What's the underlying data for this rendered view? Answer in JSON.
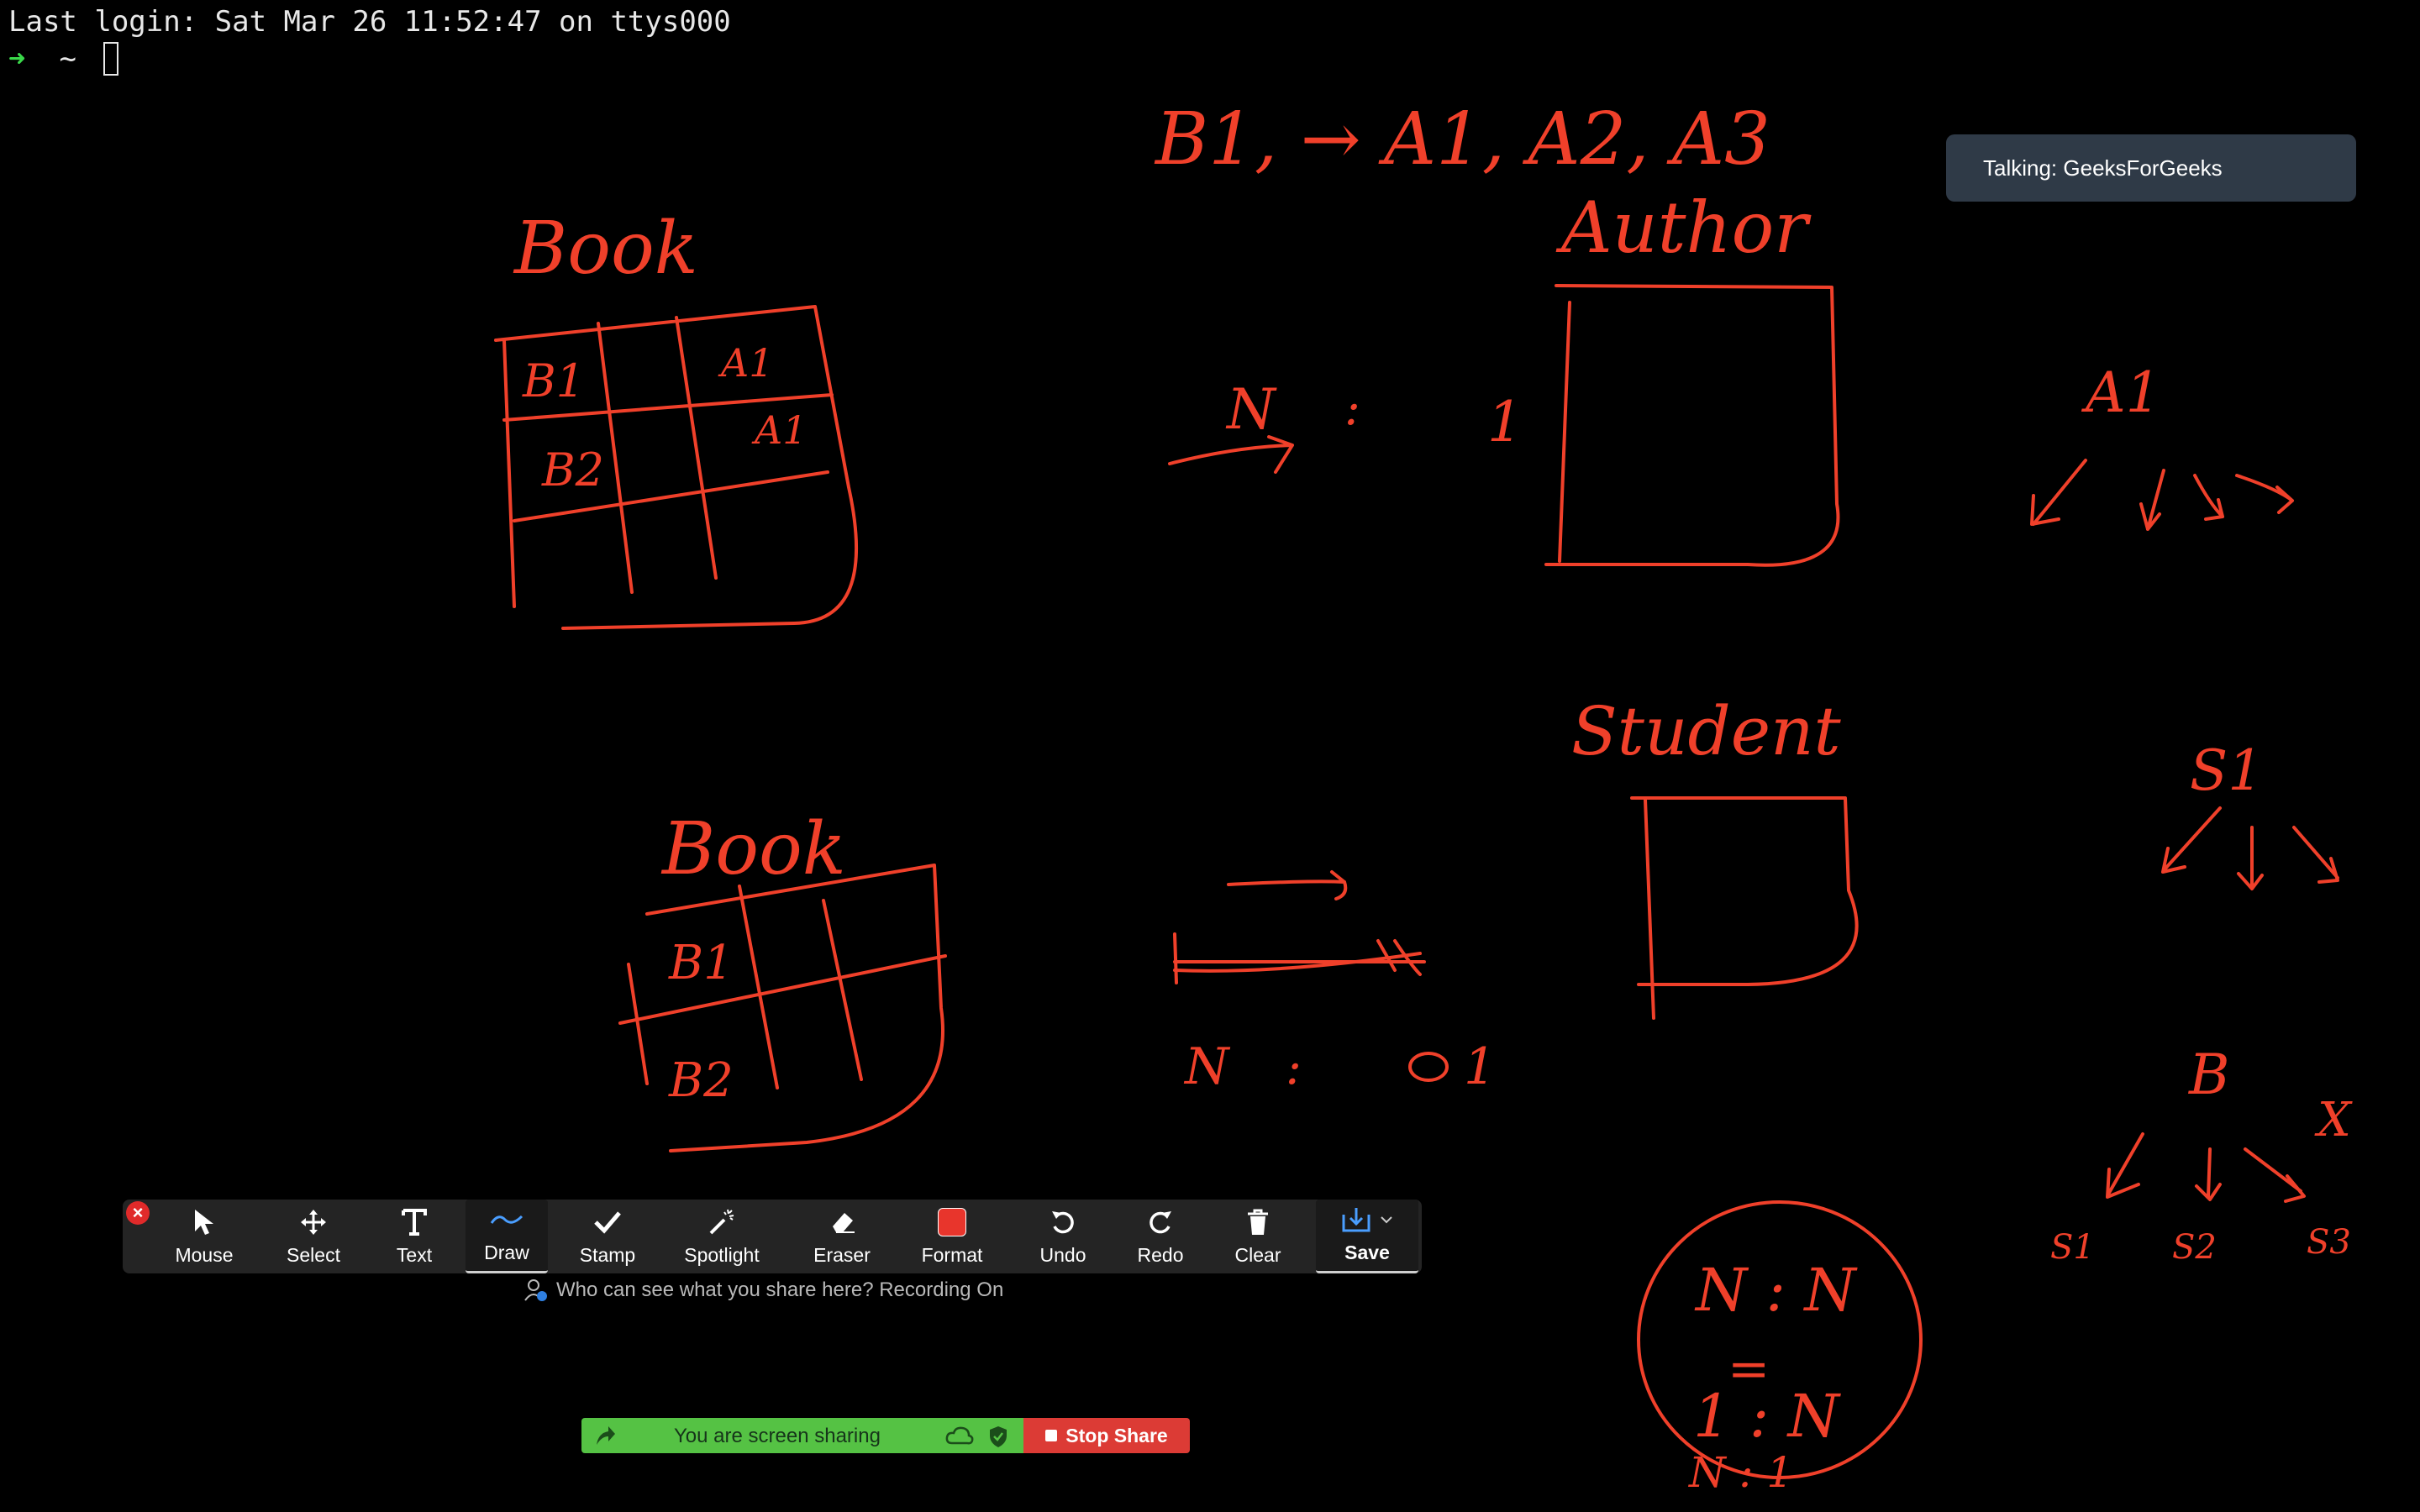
{
  "terminal": {
    "last_login": "Last login: Sat Mar 26 11:52:47 on ttys000",
    "prompt_arrow": "➜",
    "prompt_dir": "~"
  },
  "talking_badge": "Talking: GeeksForGeeks",
  "annotations": {
    "book_top": "Book",
    "book_bottom": "Book",
    "author": "Author",
    "student": "Student",
    "mapping_top": "B1, → A1, A2, A3",
    "ratio_n": "N",
    "ratio_colon": ":",
    "ratio_one": "1",
    "cell_b1": "B1",
    "cell_b2": "B2",
    "cell_a1": "A1",
    "cell_a1b": "A1",
    "tree_a1": "A1",
    "tree_s1": "S1",
    "tree_b": "B",
    "tree_x": "X",
    "leaf_s1": "S1",
    "leaf_s2": "S2",
    "leaf_s3": "S3",
    "n_to_n": "N : N",
    "one_to_n": "1 : N",
    "n_to_one": "N : 1",
    "equals": "="
  },
  "toolbar": {
    "close": "×",
    "tools": [
      {
        "label": "Mouse",
        "icon": "mouse-pointer-icon"
      },
      {
        "label": "Select",
        "icon": "move-arrows-icon"
      },
      {
        "label": "Text",
        "icon": "text-T-icon"
      },
      {
        "label": "Draw",
        "icon": "squiggle-icon"
      },
      {
        "label": "Stamp",
        "icon": "checkmark-icon"
      },
      {
        "label": "Spotlight",
        "icon": "magic-wand-icon"
      },
      {
        "label": "Eraser",
        "icon": "eraser-icon"
      },
      {
        "label": "Format",
        "icon": "color-swatch-icon"
      },
      {
        "label": "Undo",
        "icon": "undo-icon"
      },
      {
        "label": "Redo",
        "icon": "redo-icon"
      },
      {
        "label": "Clear",
        "icon": "trash-icon"
      },
      {
        "label": "Save",
        "icon": "save-icon"
      }
    ],
    "active_tool": "Draw",
    "format_color": "#e8352c"
  },
  "visibility_note": "Who can see what you share here? Recording On",
  "share_bar": {
    "message": "You are screen sharing",
    "stop_label": "Stop Share"
  },
  "colors": {
    "ink": "#f0402a",
    "accent_blue": "#4a9eff",
    "share_green": "#55c244",
    "stop_red": "#dc3b35"
  }
}
